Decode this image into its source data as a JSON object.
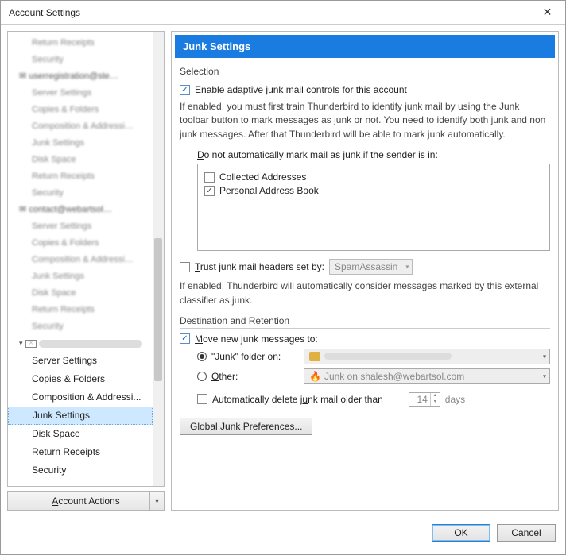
{
  "window": {
    "title": "Account Settings",
    "close_glyph": "✕"
  },
  "sidebar": {
    "blurred_groups": [
      {
        "children": [
          "Return Receipts",
          "Security"
        ]
      },
      {
        "account": "userregistration@ste...",
        "children": [
          "Server Settings",
          "Copies & Folders",
          "Composition & Addressi...",
          "Junk Settings",
          "Disk Space",
          "Return Receipts",
          "Security"
        ]
      },
      {
        "account": "contact@webartsol...",
        "children": [
          "Server Settings",
          "Copies & Folders",
          "Composition & Addressi...",
          "Junk Settings",
          "Disk Space",
          "Return Receipts",
          "Security"
        ]
      }
    ],
    "current_account_redacted": true,
    "items": [
      {
        "label": "Server Settings"
      },
      {
        "label": "Copies & Folders"
      },
      {
        "label": "Composition & Addressi..."
      },
      {
        "label": "Junk Settings",
        "selected": true
      },
      {
        "label": "Disk Space"
      },
      {
        "label": "Return Receipts"
      },
      {
        "label": "Security"
      }
    ],
    "account_actions": "Account Actions"
  },
  "panel": {
    "title": "Junk Settings",
    "selection_label": "Selection",
    "enable_checkbox": {
      "checked": true,
      "label": "Enable adaptive junk mail controls for this account"
    },
    "enable_desc": "If enabled, you must first train Thunderbird to identify junk mail by using the Junk toolbar button to mark messages as junk or not. You need to identify both junk and non junk messages. After that Thunderbird will be able to mark junk automatically.",
    "whitelist_label_pre": "D",
    "whitelist_label_rest": "o not automatically mark mail as junk if the sender is in:",
    "whitelist": [
      {
        "label": "Collected Addresses",
        "checked": false
      },
      {
        "label": "Personal Address Book",
        "checked": true
      }
    ],
    "trust_headers": {
      "checked": false,
      "label_pre": "T",
      "label_rest": "rust junk mail headers set by:",
      "select_value": "SpamAssassin"
    },
    "trust_desc": "If enabled, Thunderbird will automatically consider messages marked by this external classifier as junk.",
    "dest_label": "Destination and Retention",
    "move_checkbox": {
      "checked": true,
      "label_pre": "M",
      "label_rest": "ove new junk messages to:"
    },
    "radio_junk": {
      "on": true,
      "label": "\"Junk\" folder on:",
      "value_redacted": true
    },
    "radio_other": {
      "on": false,
      "label_pre": "O",
      "label_rest": "ther:",
      "value": "Junk on shalesh@webartsol.com"
    },
    "auto_delete": {
      "checked": false,
      "label_pre": "Automatically delete j",
      "label_underline": "u",
      "label_post": "nk mail older than",
      "days": "14",
      "days_suffix": "days"
    },
    "global_prefs": "Global Junk Preferences..."
  },
  "footer": {
    "ok": "OK",
    "cancel": "Cancel"
  }
}
